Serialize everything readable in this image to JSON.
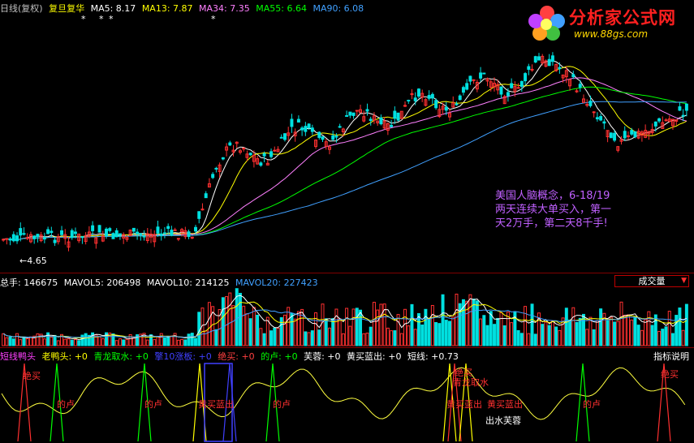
{
  "header": {
    "period": "日线(复权)",
    "stock_name": "复旦复华",
    "ma": [
      {
        "label": "MA5: 8.17",
        "color": "#ffffff"
      },
      {
        "label": "MA13: 7.87",
        "color": "#ffff00"
      },
      {
        "label": "MA34: 7.35",
        "color": "#ff80ff"
      },
      {
        "label": "MA55: 6.64",
        "color": "#00ff00"
      },
      {
        "label": "MA90: 6.08",
        "color": "#40a0ff"
      }
    ],
    "markers": [
      "*",
      "*",
      "*",
      "*"
    ]
  },
  "logo": {
    "text": "分析家公式网",
    "url": "www.88gs.com"
  },
  "price_chart": {
    "low_label": "←4.65",
    "annotation_lines": [
      "美国人脑概念，6-18/19",
      "两天连续大单买入，第一",
      "天2万手，第二天8千手!"
    ]
  },
  "volume_header": {
    "items": [
      {
        "label": "总手: 146675",
        "color": "#ffffff"
      },
      {
        "label": "MAVOL5: 206498",
        "color": "#ffffff"
      },
      {
        "label": "MAVOL10: 214125",
        "color": "#ffffff"
      },
      {
        "label": "MAVOL20: 227423",
        "color": "#40a0ff"
      }
    ],
    "dropdown_label": "成交量"
  },
  "indicator_header": {
    "items": [
      {
        "label": "短线鸭头",
        "color": "#ff40ff"
      },
      {
        "label": "老鸭头: +0",
        "color": "#ffff00"
      },
      {
        "label": "青龙取水: +0",
        "color": "#00ff00"
      },
      {
        "label": "擎10涨板: +0",
        "color": "#4040ff"
      },
      {
        "label": "绝买: +0",
        "color": "#ff4040"
      },
      {
        "label": "的卢: +0",
        "color": "#00ff00"
      },
      {
        "label": "芙蓉: +0",
        "color": "#ffffff"
      },
      {
        "label": "黄买蓝出: +0",
        "color": "#ffffff"
      },
      {
        "label": "短线: +0.73",
        "color": "#ffffff"
      }
    ],
    "help_label": "指标说明"
  },
  "indicator_labels": {
    "juemai": "绝买",
    "dilu": "的卢",
    "huangmai_lanchu": "黄买蓝出",
    "qinglong_qushui": "青龙取水",
    "chushui_furong": "出水芙蓉"
  },
  "chart_data": {
    "type": "candlestick",
    "ma_colors": {
      "ma5": "#ffffff",
      "ma13": "#ffff00",
      "ma34": "#ff80ff",
      "ma55": "#00ff00",
      "ma90": "#40a0ff"
    },
    "up_color": "#ff3030",
    "down_color": "#00e0e0"
  }
}
